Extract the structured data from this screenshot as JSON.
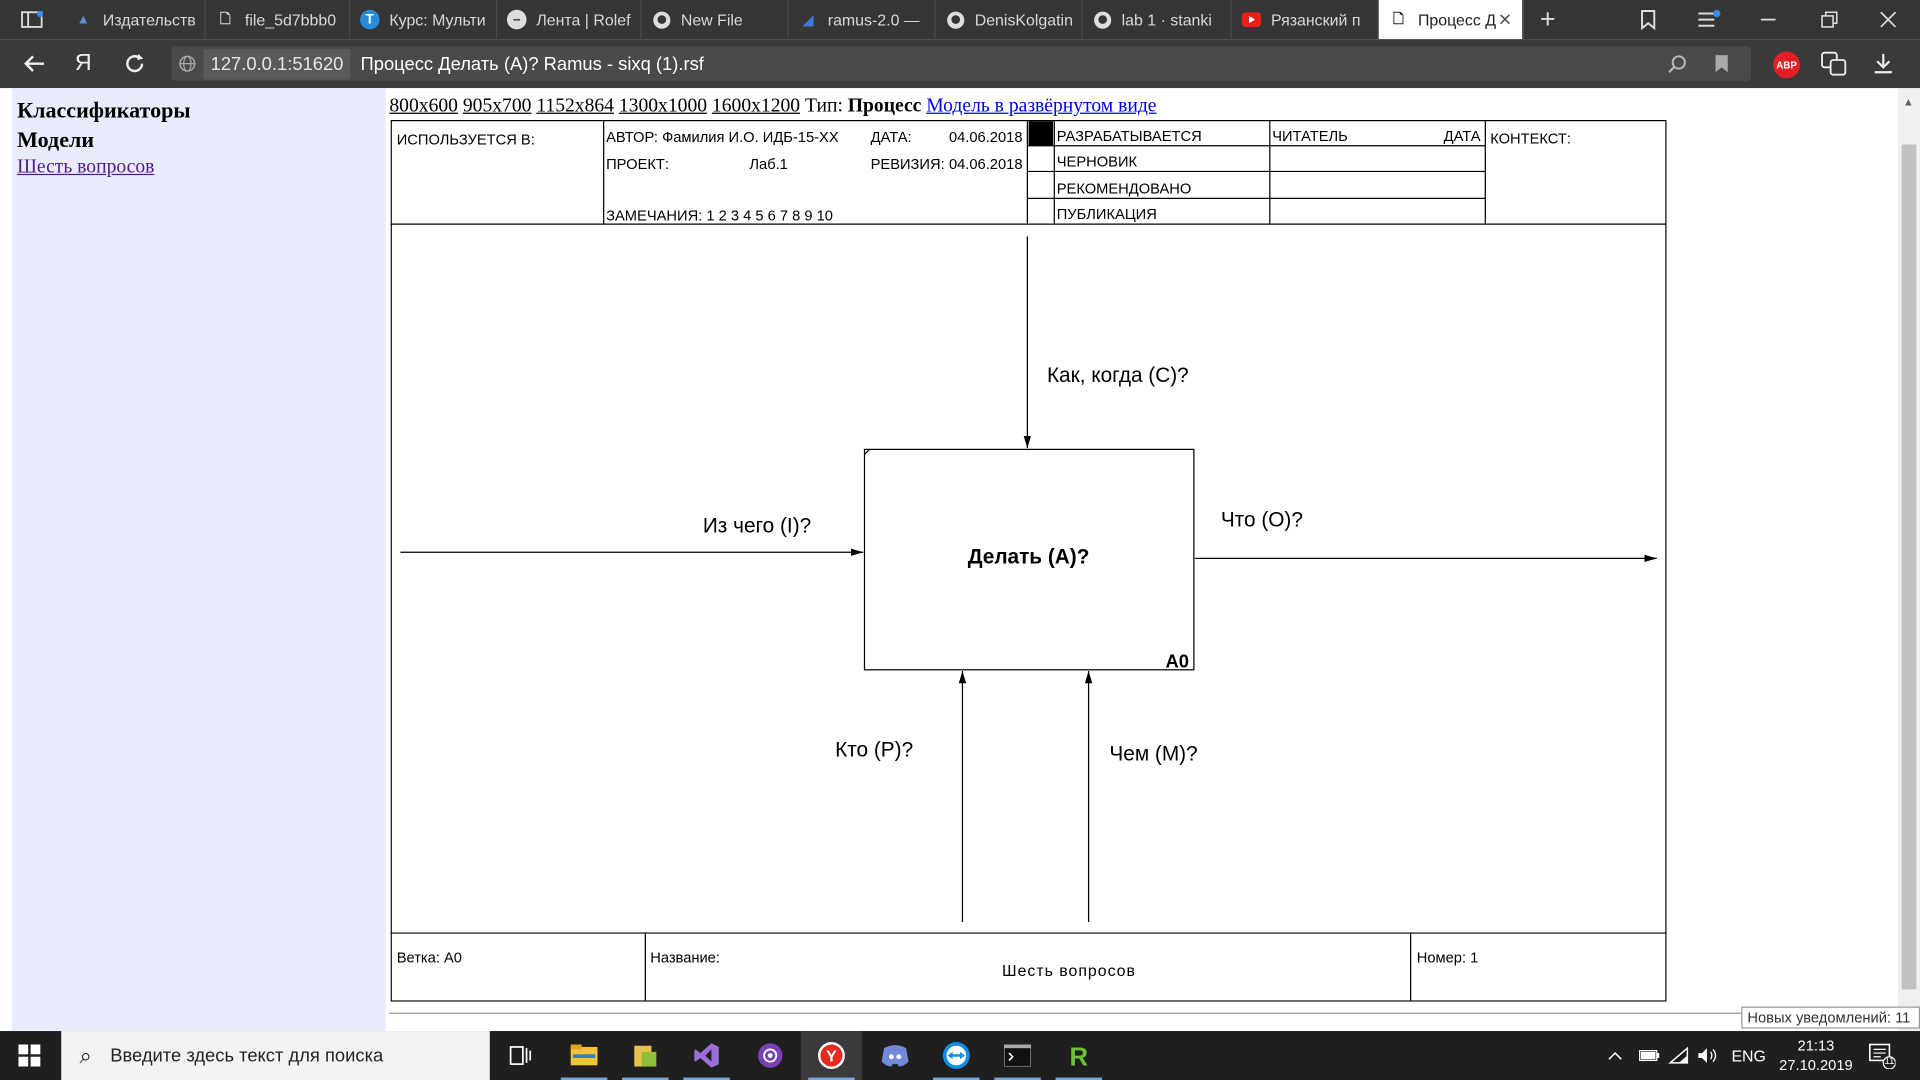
{
  "browser": {
    "tabs": [
      {
        "label": "Издательств",
        "icon": "publisher-icon"
      },
      {
        "label": "file_5d7bbb0",
        "icon": "file-icon"
      },
      {
        "label": "Курс: Мульти",
        "icon": "course-icon"
      },
      {
        "label": "Лента | Rolef",
        "icon": "feed-icon"
      },
      {
        "label": "New File",
        "icon": "github-icon"
      },
      {
        "label": "ramus-2.0 —",
        "icon": "ramus-icon"
      },
      {
        "label": "DenisKolgatin",
        "icon": "github-icon"
      },
      {
        "label": "lab 1 · stanki",
        "icon": "github-icon"
      },
      {
        "label": "Рязанский п",
        "icon": "youtube-icon"
      },
      {
        "label": "Процесс Д",
        "icon": "file-icon"
      }
    ],
    "url_host": "127.0.0.1:51620",
    "url_title": "Процесс Делать (А)? Ramus - sixq (1).rsf",
    "abp_label": "ABP",
    "nav_yandex": "Я"
  },
  "sidebar": {
    "classifiers": "Классификаторы",
    "models": "Модели",
    "link": "Шесть вопросов"
  },
  "sizebar": {
    "sizes": [
      "800x600",
      "905x700",
      "1152x864",
      "1300x1000",
      "1600x1200"
    ],
    "type_label": "Тип:",
    "type_value": "Процесс",
    "expanded_link": "Модель в развёрнутом виде"
  },
  "diagram": {
    "header": {
      "used_in": "ИСПОЛЬЗУЕТСЯ В:",
      "author": "АВТОР: Фамилия И.О. ИДБ-15-ХХ",
      "project_label": "ПРОЕКТ:",
      "project_value": "Лаб.1",
      "date_label": "ДАТА:",
      "date_value": "04.06.2018",
      "revision_label": "РЕВИЗИЯ:",
      "revision_value": "04.06.2018",
      "notes": "ЗАМЕЧАНИЯ:  1  2  3  4  5  6  7  8  9  10",
      "status": [
        "РАЗРАБАТЫВАЕТСЯ",
        "ЧЕРНОВИК",
        "РЕКОМЕНДОВАНО",
        "ПУБЛИКАЦИЯ"
      ],
      "reader": "ЧИТАТЕЛЬ",
      "reader_date": "ДАТА",
      "context": "КОНТЕКСТ:"
    },
    "box": {
      "title": "Делать (А)?",
      "number": "A0"
    },
    "arrows": {
      "control": "Как, когда (С)?",
      "input": "Из чего (I)?",
      "output": "Что (O)?",
      "mechanism_p": "Кто (P)?",
      "mechanism_m": "Чем (M)?"
    },
    "footer": {
      "branch": "Ветка: А0",
      "name_label": "Название:",
      "name_value": "Шесть вопросов",
      "number": "Номер: 1"
    }
  },
  "notification": "Новых уведомлений: 11",
  "taskbar": {
    "search_placeholder": "Введите здесь текст для поиска",
    "lang": "ENG",
    "time": "21:13",
    "date": "27.10.2019",
    "notif_count": "11"
  }
}
